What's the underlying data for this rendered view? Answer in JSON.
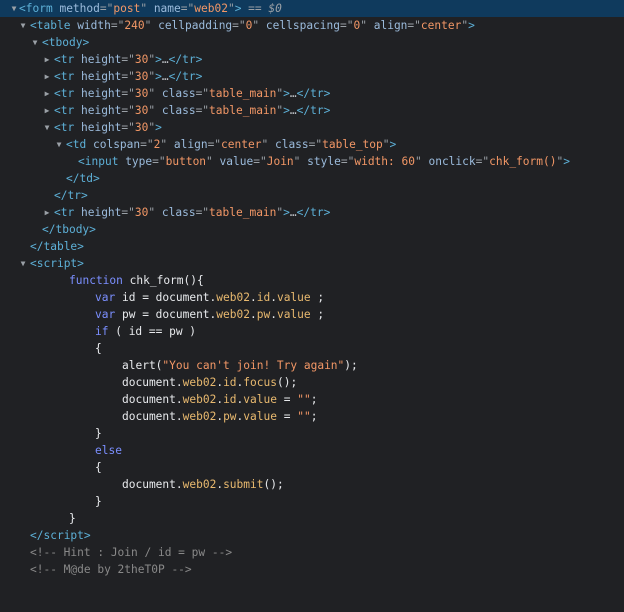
{
  "dom": {
    "form_line": {
      "tag": "form",
      "a1": "method",
      "v1": "post",
      "a2": "name",
      "v2": "web02",
      "suffix": " == ",
      "dollar": "$0"
    },
    "table_line": {
      "tag": "table",
      "a1": "width",
      "v1": "240",
      "a2": "cellpadding",
      "v2": "0",
      "a3": "cellspacing",
      "v3": "0",
      "a4": "align",
      "v4": "center"
    },
    "tbody_line": {
      "tag": "tbody"
    },
    "tr1": {
      "tag": "tr",
      "a1": "height",
      "v1": "30",
      "ellipsis": "…",
      "close": "tr"
    },
    "tr2": {
      "tag": "tr",
      "a1": "height",
      "v1": "30",
      "ellipsis": "…",
      "close": "tr"
    },
    "tr3": {
      "tag": "tr",
      "a1": "height",
      "v1": "30",
      "a2": "class",
      "v2": "table_main",
      "ellipsis": "…",
      "close": "tr"
    },
    "tr4": {
      "tag": "tr",
      "a1": "height",
      "v1": "30",
      "a2": "class",
      "v2": "table_main",
      "ellipsis": "…",
      "close": "tr"
    },
    "tr5": {
      "tag": "tr",
      "a1": "height",
      "v1": "30"
    },
    "td_line": {
      "tag": "td",
      "a1": "colspan",
      "v1": "2",
      "a2": "align",
      "v2": "center",
      "a3": "class",
      "v3": "table_top"
    },
    "input_line": {
      "tag": "input",
      "a1": "type",
      "v1": "button",
      "a2": "value",
      "v2": "Join",
      "a3": "style",
      "v3": "width: 60",
      "a4": "onclick",
      "v4": "chk_form()"
    },
    "td_close": "td",
    "tr5_close": "tr",
    "tr6": {
      "tag": "tr",
      "a1": "height",
      "v1": "30",
      "a2": "class",
      "v2": "table_main",
      "ellipsis": "…",
      "close": "tr"
    },
    "tbody_close": "tbody",
    "table_close": "table",
    "script_open": "script",
    "script_close": "script"
  },
  "code": {
    "l1": {
      "kw": "function",
      "name": "chk_form(){"
    },
    "l2": {
      "kw": "var",
      "var": "id",
      "eq": " = document.",
      "obj": "web02",
      "dot1": ".",
      "p1": "id",
      "dot2": ".",
      "p2": "value",
      "end": " ;"
    },
    "l3": {
      "kw": "var",
      "var": "pw",
      "eq": " = document.",
      "obj": "web02",
      "dot1": ".",
      "p1": "pw",
      "dot2": ".",
      "p2": "value",
      "end": " ;"
    },
    "l4": {
      "kw": "if",
      "rest": " ( id == pw )"
    },
    "l5": "{",
    "l6": {
      "fn": "alert(",
      "str": "\"You can't join! Try again\"",
      "end": ");"
    },
    "l7": {
      "pre": "document.",
      "obj": "web02",
      "dot1": ".",
      "p1": "id",
      "dot2": ".",
      "p2": "focus",
      "end": "();"
    },
    "l8": {
      "pre": "document.",
      "obj": "web02",
      "dot1": ".",
      "p1": "id",
      "dot2": ".",
      "p2": "value",
      "eq": " = ",
      "str": "\"\"",
      "end": ";"
    },
    "l9": {
      "pre": "document.",
      "obj": "web02",
      "dot1": ".",
      "p1": "pw",
      "dot2": ".",
      "p2": "value",
      "eq": " = ",
      "str": "\"\"",
      "end": ";"
    },
    "l10": "}",
    "l11": {
      "kw": "else"
    },
    "l12": "{",
    "l13": {
      "pre": "document.",
      "obj": "web02",
      "dot1": ".",
      "p2": "submit",
      "end": "();"
    },
    "l14": "}",
    "l15": "}"
  },
  "comments": {
    "hint": "<!-- Hint : Join / id = pw -->",
    "made": "<!-- M@de by 2theT0P -->"
  },
  "colors": {
    "background": "#202124",
    "selected_row": "#0f3a5d",
    "tag": "#5db0d7",
    "attr": "#9bbbdc",
    "value": "#f29766",
    "comment": "#898989",
    "keyword": "#7b8fff"
  }
}
